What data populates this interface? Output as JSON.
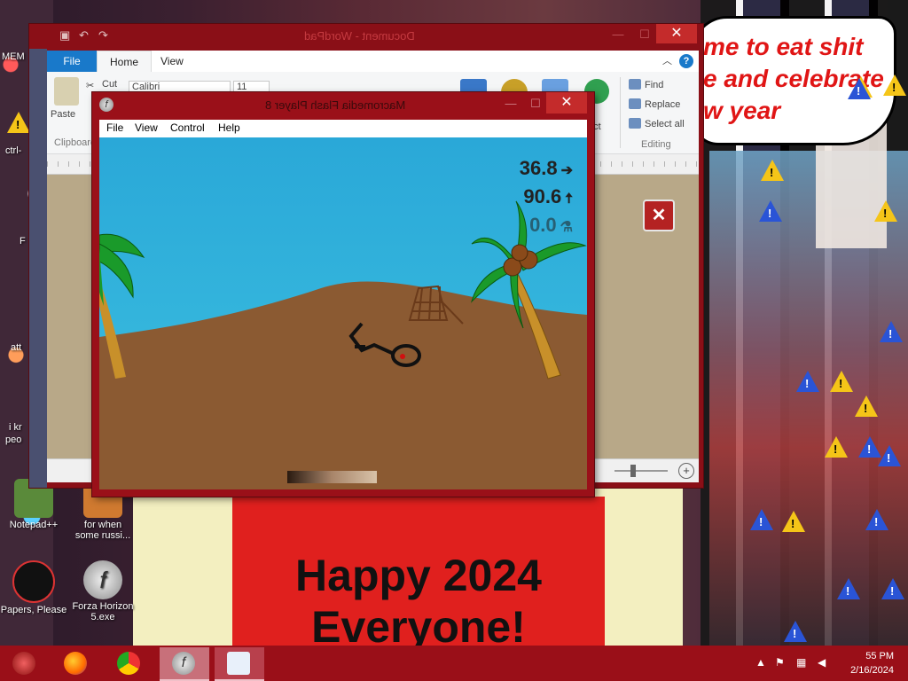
{
  "wallpaper": {
    "speech_bubble_text": "me to eat shit\ne and celebrate\nw year",
    "shirt_text": "Happy 2024\nEveryone!"
  },
  "desktop_icons": [
    {
      "label": "Notepad++"
    },
    {
      "label": "for when\nsome russi..."
    },
    {
      "label": "Papers, Please"
    },
    {
      "label": "Forza Horizon\n5.exe"
    }
  ],
  "desktop_partial_labels": {
    "mem": "MEM",
    "ctrl": "ctrl-",
    "f": "F",
    "att": "att",
    "ikr": "i kr",
    "peo": "peo"
  },
  "wordpad": {
    "title": "Document - WordPad",
    "file_tab": "File",
    "tabs": [
      "Home",
      "View"
    ],
    "help": "?",
    "ribbon": {
      "paste": "Paste",
      "cut": "Cut",
      "clipboard": "Clipboard",
      "font_name": "Calibri",
      "font_size": "11",
      "find": "Find",
      "replace": "Replace",
      "select_all": "Select all",
      "editing": "Editing",
      "insert_object_partial": "rt\nect"
    },
    "close": "✕",
    "zoom_plus": "+"
  },
  "flash": {
    "title": "Macromedia Flash Player 8",
    "menu": [
      "File",
      "View",
      "Control",
      "Help"
    ],
    "close": "✕",
    "stats": {
      "speed": "36.8",
      "height": "90.6",
      "fuel": "0.0"
    },
    "power_fraction": 0.45
  },
  "taskbar": {
    "time": "55 PM",
    "date": "2/16/2024"
  },
  "colors": {
    "accent": "#9a0f18",
    "sky": "#2aa8d8",
    "sand": "#8b5a32",
    "warning": "#f5c518"
  }
}
